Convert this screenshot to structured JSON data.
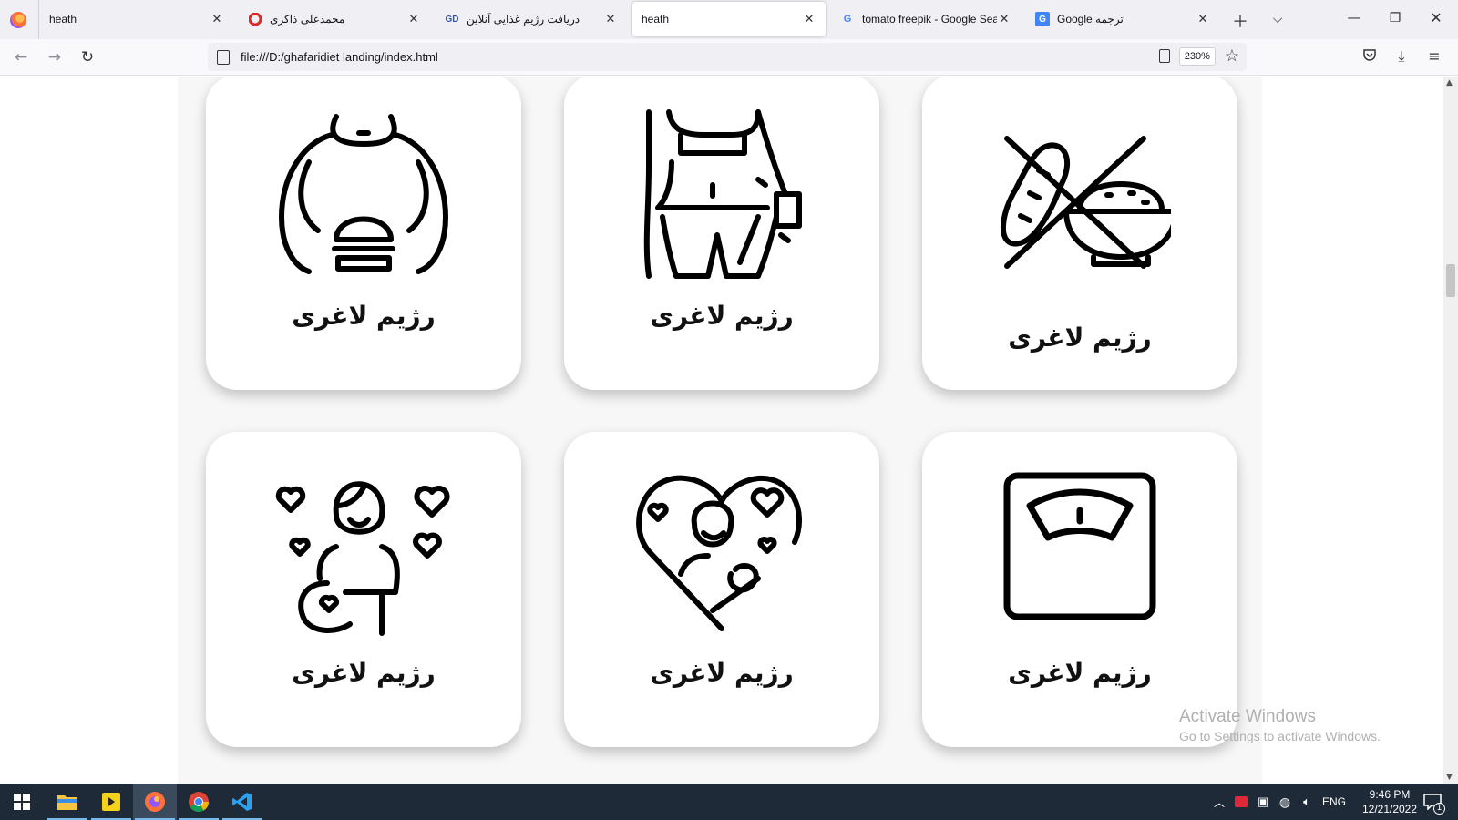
{
  "tabs": [
    {
      "title": "heath",
      "favicon": "firefox-page-icon",
      "active": false
    },
    {
      "title": "محمدعلی ذاکری",
      "favicon": "opera-icon",
      "active": false
    },
    {
      "title": "دریافت رژیم غذایی آنلاین",
      "favicon": "site-logo-icon",
      "active": false
    },
    {
      "title": "heath",
      "favicon": "none",
      "active": true
    },
    {
      "title": "tomato freepik - Google Searc",
      "favicon": "google-icon",
      "active": false
    },
    {
      "title": "Google ترجمه",
      "favicon": "google-translate-icon",
      "active": false
    }
  ],
  "navbar": {
    "url": "file:///D:/ghafaridiet landing/index.html",
    "zoom": "230%"
  },
  "cards": [
    {
      "label": "رژیم لاغری",
      "icon": "obese-burger-icon"
    },
    {
      "label": "رژیم لاغری",
      "icon": "slim-waist-measure-icon"
    },
    {
      "label": "رژیم لاغری",
      "icon": "no-carbs-icon"
    },
    {
      "label": "رژیم لاغری",
      "icon": "pregnant-woman-icon"
    },
    {
      "label": "رژیم لاغری",
      "icon": "mother-baby-heart-icon"
    },
    {
      "label": "رژیم لاغری",
      "icon": "weight-scale-icon"
    }
  ],
  "watermark": {
    "line1": "Activate Windows",
    "line2": "Go to Settings to activate Windows."
  },
  "taskbar": {
    "language": "ENG",
    "time": "9:46 PM",
    "date": "12/21/2022",
    "notification_count": "1"
  }
}
